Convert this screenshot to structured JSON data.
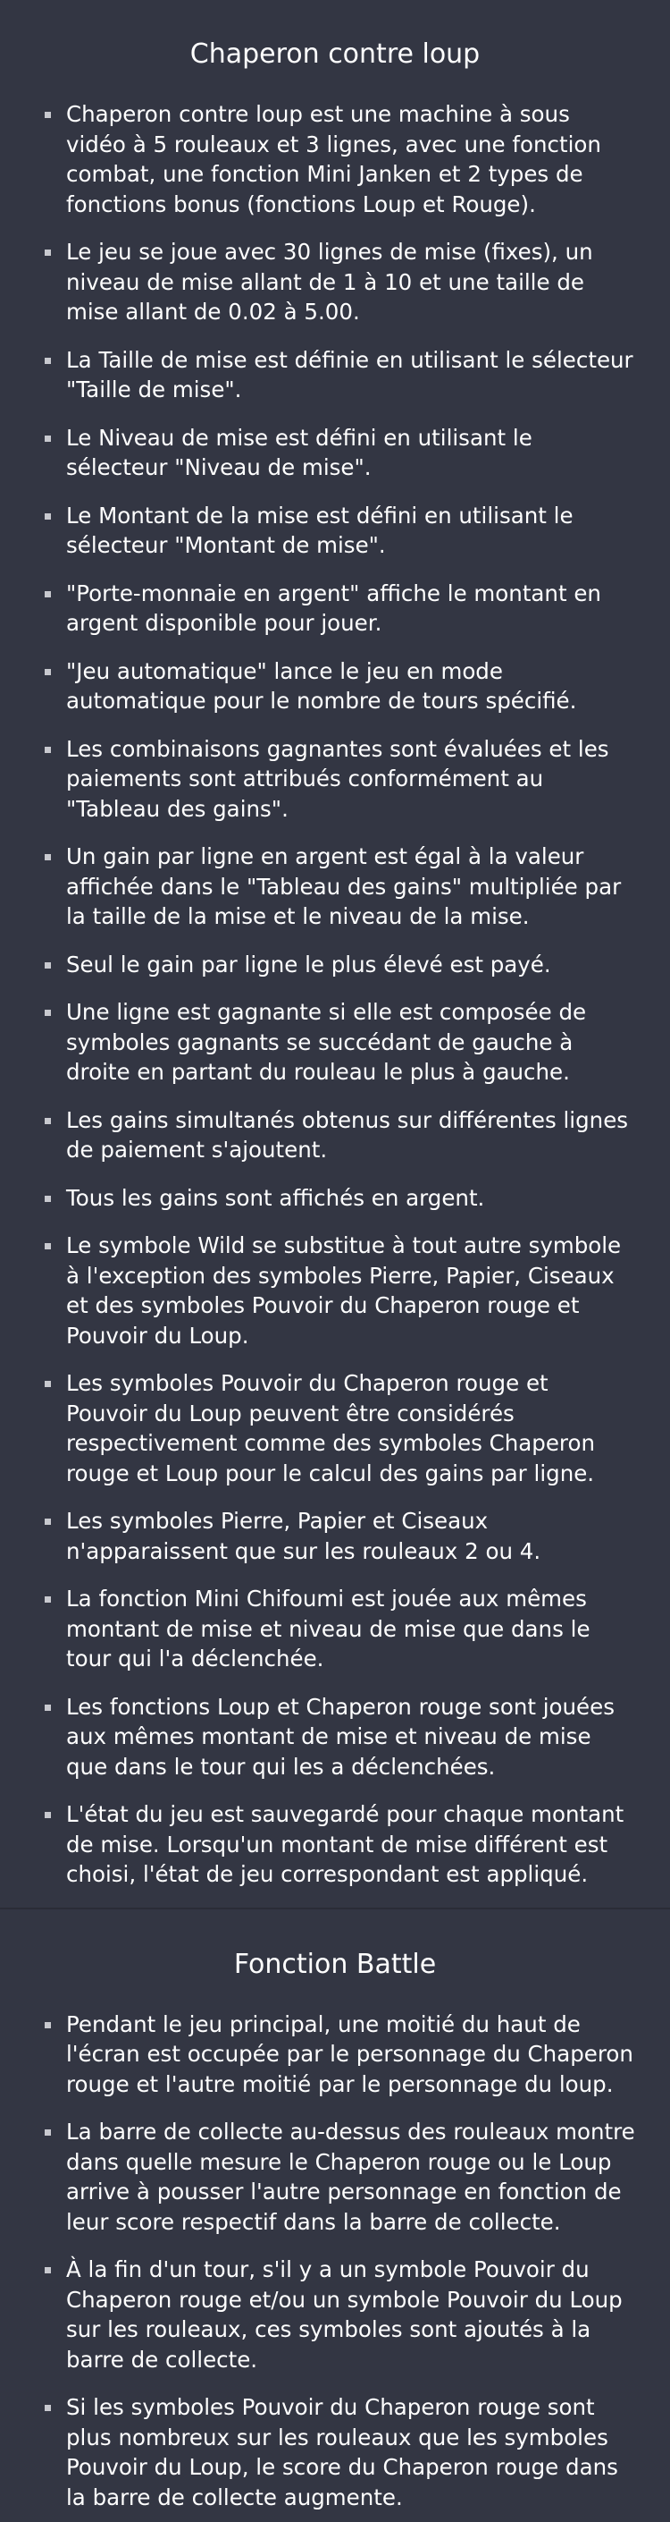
{
  "sections": [
    {
      "title": "Chaperon contre loup",
      "items": [
        "Chaperon contre loup est une machine à sous vidéo à 5 rouleaux et 3 lignes, avec une fonction combat, une fonction Mini Janken et 2 types de fonctions bonus (fonctions Loup et Rouge).",
        "Le jeu se joue avec 30 lignes de mise (fixes), un niveau de mise allant de 1 à 10 et une taille de mise allant de 0.02 à 5.00.",
        "La Taille de mise est définie en utilisant le sélecteur \"Taille de mise\".",
        "Le Niveau de mise est défini en utilisant le sélecteur \"Niveau de mise\".",
        "Le Montant de la mise est défini en utilisant le sélecteur \"Montant de mise\".",
        "\"Porte-monnaie en argent\" affiche le montant en argent disponible pour jouer.",
        "\"Jeu automatique\" lance le jeu en mode automatique pour le nombre de tours spécifié.",
        "Les combinaisons gagnantes sont évaluées et les paiements sont attribués conformément au \"Tableau des gains\".",
        "Un gain par ligne en argent est égal à la valeur affichée dans le \"Tableau des gains\" multipliée par la taille de la mise et le niveau de la mise.",
        "Seul le gain par ligne le plus élevé est payé.",
        "Une ligne est gagnante si elle est composée de symboles gagnants se succédant de gauche à droite en partant du rouleau le plus à gauche.",
        "Les gains simultanés obtenus sur différentes lignes de paiement s'ajoutent.",
        "Tous les gains sont affichés en argent.",
        "Le symbole Wild se substitue à tout autre symbole à l'exception des symboles Pierre, Papier, Ciseaux et des symboles Pouvoir du Chaperon rouge et Pouvoir du Loup.",
        "Les symboles Pouvoir du Chaperon rouge et Pouvoir du Loup peuvent être considérés respectivement comme des symboles Chaperon rouge et Loup pour le calcul des gains par ligne.",
        "Les symboles Pierre, Papier et Ciseaux n'apparaissent que sur les rouleaux 2 ou 4.",
        "La fonction Mini Chifoumi est jouée aux mêmes montant de mise et niveau de mise que dans le tour qui l'a déclenchée.",
        "Les fonctions Loup et Chaperon rouge sont jouées aux mêmes montant de mise et niveau de mise que dans le tour qui les a déclenchées.",
        "L'état du jeu est sauvegardé pour chaque montant de mise. Lorsqu'un montant de mise différent est choisi, l'état de jeu correspondant est appliqué."
      ]
    },
    {
      "title": "Fonction Battle",
      "items": [
        "Pendant le jeu principal, une moitié du haut de l'écran est occupée par le personnage du Chaperon rouge et l'autre moitié par le personnage du loup.",
        "La barre de collecte au-dessus des rouleaux montre dans quelle mesure le Chaperon rouge ou le Loup arrive à pousser l'autre personnage en fonction de leur score respectif dans la barre de collecte.",
        "À la fin d'un tour, s'il y a un symbole Pouvoir du Chaperon rouge et/ou un symbole Pouvoir du Loup sur les rouleaux, ces symboles sont ajoutés à la barre de collecte.",
        "Si les symboles Pouvoir du Chaperon rouge sont plus nombreux sur les rouleaux que les symboles Pouvoir du Loup, le score du Chaperon rouge dans la barre de collecte augmente."
      ]
    }
  ]
}
